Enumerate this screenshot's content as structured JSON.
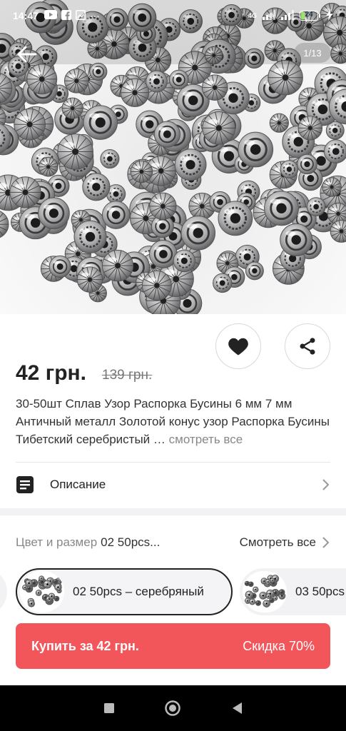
{
  "status_bar": {
    "time": "14:47",
    "more": "···",
    "network": "4G",
    "battery_level": "24",
    "battery_fraction": 0.24
  },
  "gallery": {
    "counter": "1/13"
  },
  "product": {
    "price": "42 грн.",
    "old_price": "139 грн.",
    "title": "30-50шт Сплав Узор Распорка Бусины 6 мм 7 мм Античный металл Золотой конус узор Распорка Бусины Тибетский серебристый …",
    "see_all": "смотреть все"
  },
  "description": {
    "label": "Описание"
  },
  "variants": {
    "label": "Цвет и размер",
    "selected_value": "02 50pcs...",
    "see_all": "Смотреть все",
    "options": [
      {
        "label": "02 50pcs – серебряный"
      },
      {
        "label": "03 50pcs"
      }
    ]
  },
  "buy": {
    "label": "Купить за 42 грн.",
    "discount": "Скидка 70%"
  },
  "colors": {
    "accent": "#f2565a",
    "text": "#222222",
    "muted": "#888888"
  }
}
